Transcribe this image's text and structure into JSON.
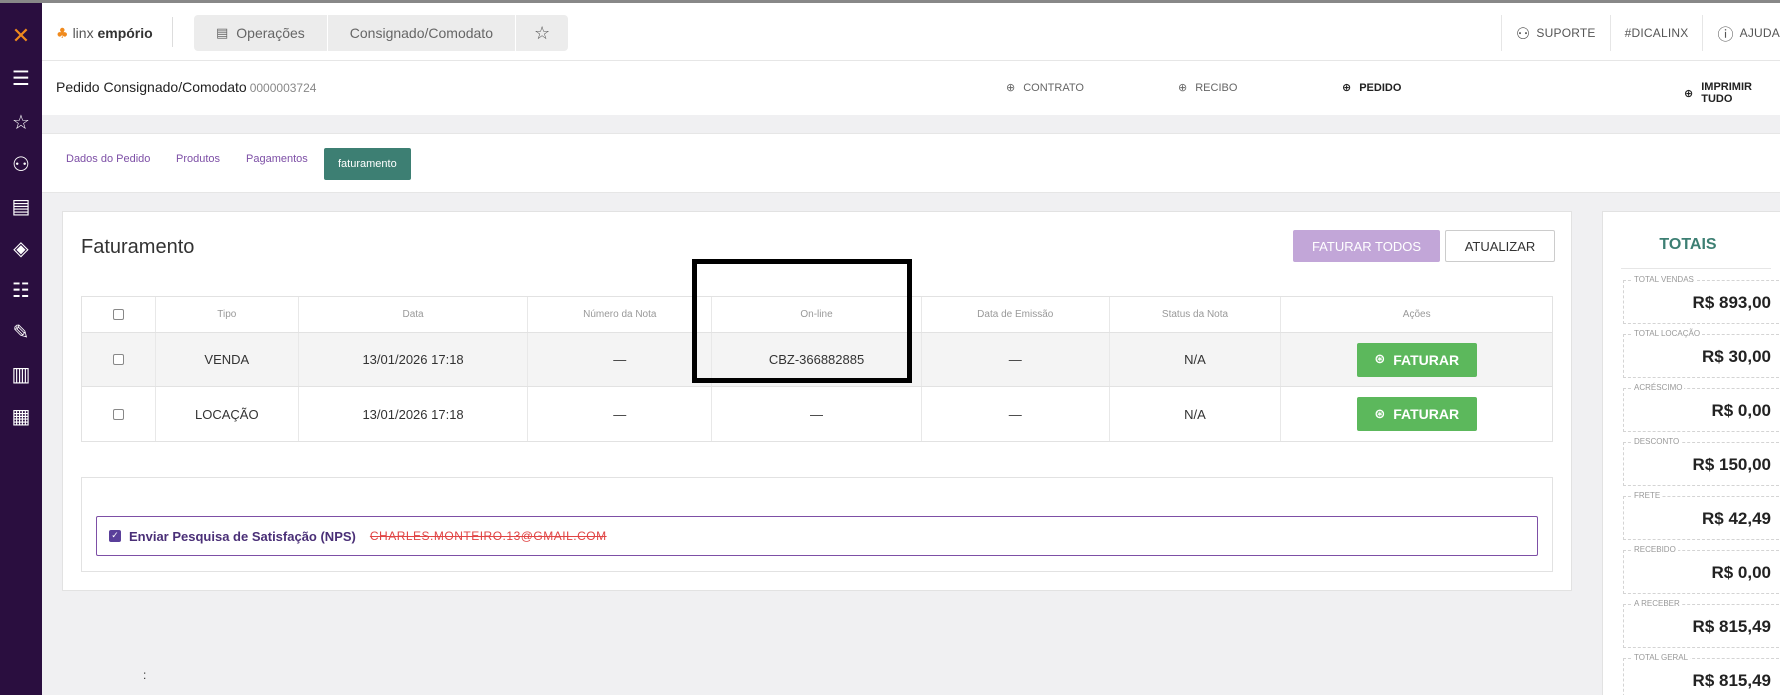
{
  "sidebar": {
    "icons": [
      "linx-logo-icon",
      "menu-icon",
      "star-icon",
      "users-icon",
      "clipboard-icon",
      "tag-icon",
      "list-icon",
      "edit-icon",
      "chart-icon",
      "building-icon"
    ]
  },
  "topbar": {
    "brand_light": "linx",
    "brand_bold": "empório",
    "breadcrumbs": [
      "Operações",
      "Consignado/Comodato"
    ],
    "links": {
      "suporte": "SUPORTE",
      "dicalinx": "#DICALINX",
      "ajuda": "AJUDA"
    }
  },
  "titlebar": {
    "title": "Pedido Consignado/Comodato",
    "number": "0000003724",
    "actions": {
      "contrato": "CONTRATO",
      "recibo": "RECIBO",
      "pedido": "PEDIDO",
      "imprimir_tudo": "IMPRIMIR TUDO"
    }
  },
  "tabs": {
    "dados": "Dados do Pedido",
    "produtos": "Produtos",
    "pagamentos": "Pagamentos",
    "faturamento": "faturamento"
  },
  "card": {
    "title": "Faturamento",
    "faturar_todos": "FATURAR TODOS",
    "atualizar": "ATUALIZAR"
  },
  "table": {
    "headers": {
      "tipo": "Tipo",
      "data": "Data",
      "numero": "Número da Nota",
      "online": "On-line",
      "emissao": "Data de Emissão",
      "status": "Status da Nota",
      "acoes": "Ações"
    },
    "rows": [
      {
        "tipo": "VENDA",
        "data": "13/01/2026 17:18",
        "numero": "—",
        "online": "CBZ-366882885",
        "emissao": "—",
        "status": "N/A",
        "action": "FATURAR"
      },
      {
        "tipo": "LOCAÇÃO",
        "data": "13/01/2026 17:18",
        "numero": "—",
        "online": "—",
        "emissao": "—",
        "status": "N/A",
        "action": "FATURAR"
      }
    ]
  },
  "colon_text": ":",
  "nps": {
    "label": "Enviar Pesquisa de Satisfação (NPS)",
    "email": "CHARLES.MONTEIRO.13@GMAIL.COM"
  },
  "totals": {
    "title": "TOTAIS",
    "items": [
      {
        "label": "TOTAL VENDAS",
        "value": "R$ 893,00"
      },
      {
        "label": "TOTAL LOCAÇÃO",
        "value": "R$ 30,00"
      },
      {
        "label": "ACRÉSCIMO",
        "value": "R$ 0,00"
      },
      {
        "label": "DESCONTO",
        "value": "R$ 150,00"
      },
      {
        "label": "FRETE",
        "value": "R$ 42,49"
      },
      {
        "label": "RECEBIDO",
        "value": "R$ 0,00"
      },
      {
        "label": "A RECEBER",
        "value": "R$ 815,49"
      },
      {
        "label": "TOTAL GERAL",
        "value": "R$ 815,49"
      }
    ]
  },
  "colors": {
    "sidebar": "#2a0e3f",
    "accent_purple": "#7d4fa6",
    "tab_active": "#3d7f73",
    "faturar_green": "#5cb85c",
    "faturar_todos_disabled": "#c2a6d8",
    "nps_email_red": "#e04444"
  }
}
